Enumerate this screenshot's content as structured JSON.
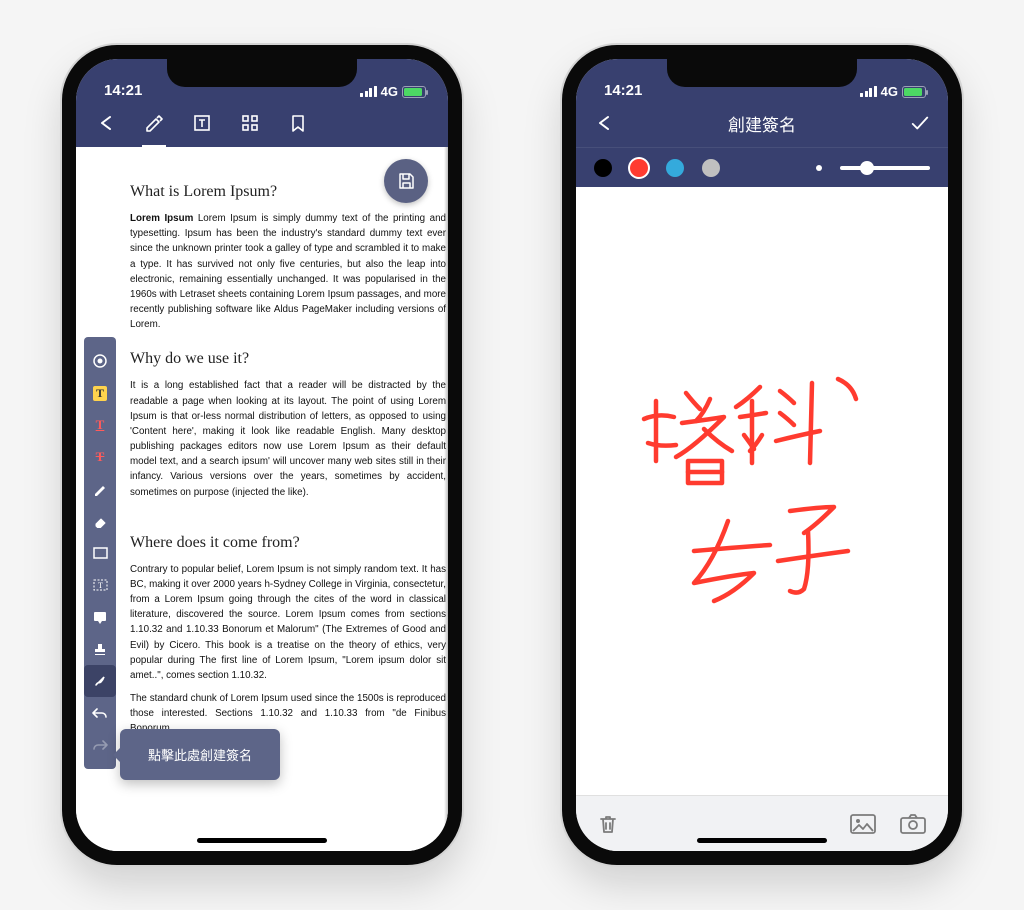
{
  "status": {
    "time": "14:21",
    "network": "4G"
  },
  "left": {
    "tooltip": "點擊此處創建簽名",
    "doc": {
      "title1": "What is Lorem Ipsum?",
      "para1": "Lorem Ipsum is simply dummy text of the printing and typesetting. Ipsum has been the industry's standard dummy text ever since the unknown printer took a galley of type and scrambled it to make a type. It has survived not only five centuries, but also the leap into electronic, remaining essentially unchanged. It was popularised in the 1960s with Letraset sheets containing Lorem Ipsum passages, and more recently publishing software like Aldus PageMaker including versions of Lorem.",
      "boldLead": "Lorem Ipsum",
      "title2": "Why do we use it?",
      "para2": "It is a long established fact that a reader will be distracted by the readable a page when looking at its layout. The point of using Lorem Ipsum is that or-less normal distribution of letters, as opposed to using 'Content here', making it look like readable English. Many desktop publishing packages editors now use Lorem Ipsum as their default model text, and a search ipsum' will uncover many web sites still in their infancy. Various versions over the years, sometimes by accident, sometimes on purpose (injected the like).",
      "title3": "Where does it come from?",
      "para3": "Contrary to popular belief, Lorem Ipsum is not simply random text. It has BC, making it over 2000 years h-Sydney College in Virginia, consectetur, from a Lorem Ipsum going through the cites of the word in classical literature, discovered the source. Lorem Ipsum comes from sections 1.10.32 and 1.10.33 Bonorum et Malorum\" (The Extremes of Good and Evil) by Cicero. This book is a treatise on the theory of ethics, very popular during The first line of Lorem Ipsum, \"Lorem ipsum dolor sit amet..\", comes section 1.10.32.",
      "para4": "The standard chunk of Lorem Ipsum used since the 1500s is reproduced those interested. Sections 1.10.32 and 1.10.33 from \"de Finibus Bonorum"
    }
  },
  "right": {
    "title": "創建簽名",
    "colors": [
      "#000000",
      "#ff3b30",
      "#34aadc",
      "#c0c0c0"
    ],
    "selectedColor": 1,
    "handwriting": "塔科 女子"
  }
}
